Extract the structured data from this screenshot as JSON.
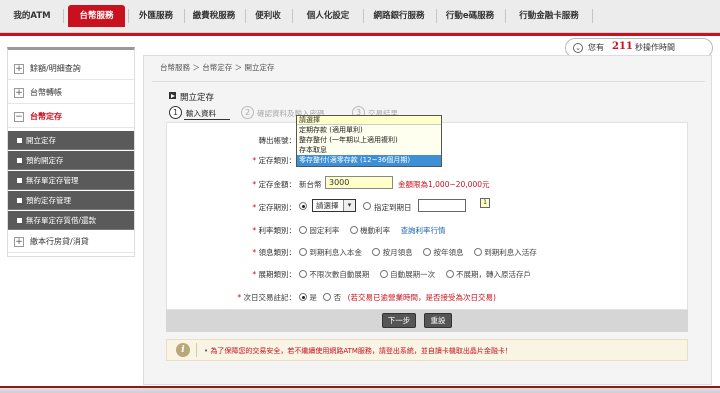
{
  "topnav": {
    "tabs": [
      {
        "label": "我的ATM"
      },
      {
        "label": "台幣服務"
      },
      {
        "label": "外匯服務"
      },
      {
        "label": "繳費稅服務"
      },
      {
        "label": "便利收"
      },
      {
        "label": "個人化設定"
      },
      {
        "label": "網路銀行服務"
      },
      {
        "label": "行動e碼服務"
      },
      {
        "label": "行動金融卡服務"
      }
    ],
    "active_tab": "台幣服務",
    "accent_color": "#c8101e"
  },
  "timer": {
    "prefix": "您有",
    "seconds": "211",
    "suffix": "秒操作時間"
  },
  "sidebar": {
    "items": [
      {
        "label": "餘額/明細查詢",
        "toggle": "+"
      },
      {
        "label": "台幣轉帳",
        "toggle": "+"
      },
      {
        "label": "台幣定存",
        "toggle": "−"
      }
    ],
    "sub_items": [
      {
        "label": "開立定存"
      },
      {
        "label": "預約開定存"
      },
      {
        "label": "無存單定存管理"
      },
      {
        "label": "預約定存管理"
      },
      {
        "label": "無存單定存質借/還款"
      }
    ],
    "bottom_item": {
      "label": "繳本行房貸/消貸",
      "toggle": "+"
    }
  },
  "breadcrumb": "台幣服務 ＞ 台幣定存 ＞ 開立定存",
  "page_title": "開立定存",
  "steps": [
    {
      "num": "1",
      "label": "輸入資料"
    },
    {
      "num": "2",
      "label": "確認資料及輸入密碼"
    },
    {
      "num": "3",
      "label": "交易結果"
    }
  ],
  "form": {
    "account_label": "轉出帳號：",
    "account_value": "",
    "type_label": "定存類別：",
    "type_dropdown": {
      "options": [
        "請選擇",
        "定期存款 (適用單利)",
        "整存整付 (一年期以上適用複利)",
        "存本取息",
        "零存整付(適零存款 (12~36個月期)"
      ],
      "highlighted_index": 4
    },
    "amount_label": "定存金額：",
    "amount_currency": "新台幣",
    "amount_value": "3000",
    "amount_hint": "金額限為1,000~20,000元",
    "period_label": "定存期別：",
    "period_select": "請選擇",
    "period_alt": "指定到期日",
    "rate_label": "利率類別：",
    "rate_options": [
      "固定利率",
      "機動利率"
    ],
    "rate_link": "查詢利率行情",
    "interest_label": "領息類別：",
    "interest_options": [
      "到期利息入本金",
      "按月領息",
      "按年領息",
      "到期利息入活存"
    ],
    "renew_label": "展期類別：",
    "renew_options": [
      "不限次數自動展期",
      "自動展期一次",
      "不展期，轉入原活存戶"
    ],
    "nextday_label": "次日交易註記：",
    "nextday_options": [
      "是",
      "否"
    ],
    "nextday_note": "(若交易已逾營業時間，是否接受為次日交易)"
  },
  "buttons": {
    "next": "下一步",
    "reset": "重設"
  },
  "notice": "為了保障您的交易安全，若不繼續使用網路ATM服務，請登出系統，並自讀卡機取出晶片金融卡！"
}
